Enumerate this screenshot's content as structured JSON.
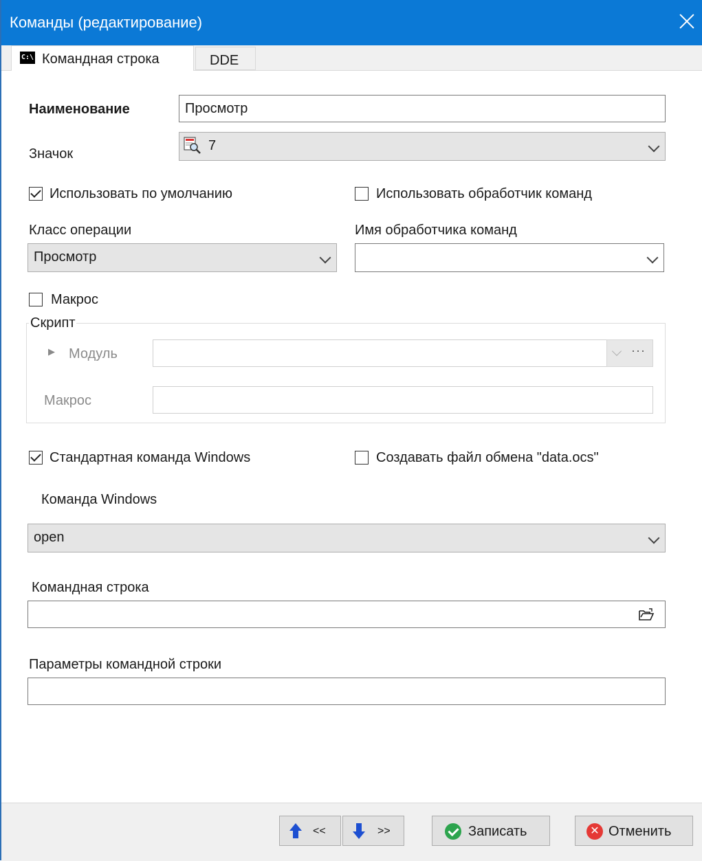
{
  "window": {
    "title": "Команды (редактирование)"
  },
  "tabs": [
    {
      "label": "Командная строка",
      "icon": "command-prompt-icon",
      "active": true
    },
    {
      "label": "DDE",
      "active": false
    }
  ],
  "fields": {
    "name_label": "Наименование",
    "name_value": "Просмотр",
    "icon_label": "Значок",
    "icon_value": "7",
    "use_default_label": "Использовать по умолчанию",
    "use_default_checked": true,
    "use_handler_label": "Использовать обработчик команд",
    "use_handler_checked": false,
    "op_class_label": "Класс операции",
    "op_class_value": "Просмотр",
    "handler_name_label": "Имя обработчика команд",
    "handler_name_value": "",
    "macro_label": "Макрос",
    "macro_checked": false
  },
  "script_group": {
    "legend": "Скрипт",
    "module_label": "Модуль",
    "module_value": "",
    "macro_label": "Макрос",
    "macro_value": "",
    "more_button": "···"
  },
  "windows_cmd": {
    "std_label": "Стандартная команда Windows",
    "std_checked": true,
    "exchange_label": "Создавать файл обмена \"data.ocs\"",
    "exchange_checked": false,
    "cmd_label": "Команда Windows",
    "cmd_value": "open",
    "cmdline_label": "Командная строка",
    "cmdline_value": "",
    "params_label": "Параметры командной строки",
    "params_value": ""
  },
  "footer": {
    "prev_label": "<<",
    "next_label": ">>",
    "save_label": "Записать",
    "cancel_label": "Отменить"
  },
  "colors": {
    "titlebar": "#0b79d6",
    "arrow": "#1d4fd1",
    "ok": "#2da44e",
    "cancel": "#e53935"
  }
}
